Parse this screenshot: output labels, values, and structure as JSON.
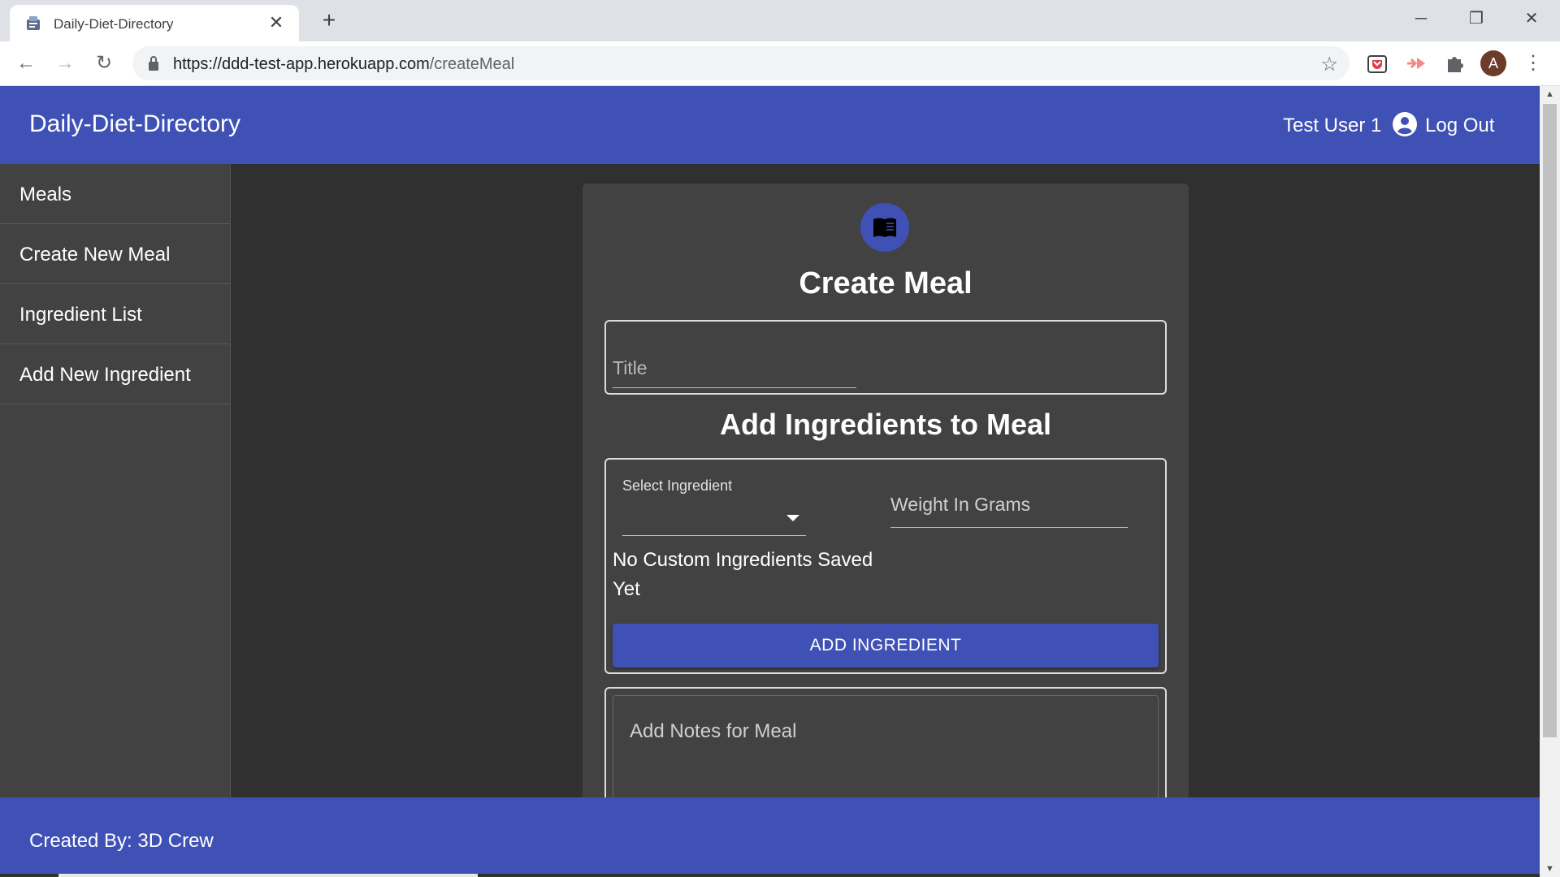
{
  "browser": {
    "tab_title": "Daily-Diet-Directory",
    "url_base": "https://ddd-test-app.herokuapp.com",
    "url_path": "/createMeal",
    "profile_initial": "A"
  },
  "header": {
    "brand": "Daily-Diet-Directory",
    "user_name": "Test User 1",
    "logout_label": "Log Out"
  },
  "sidebar": {
    "items": [
      {
        "label": "Meals"
      },
      {
        "label": "Create New Meal"
      },
      {
        "label": "Ingredient List"
      },
      {
        "label": "Add New Ingredient"
      }
    ]
  },
  "form": {
    "title": "Create Meal",
    "title_placeholder": "Title",
    "ingredients_heading": "Add Ingredients to Meal",
    "select_label": "Select Ingredient",
    "select_value": "",
    "weight_placeholder": "Weight In Grams",
    "no_custom_message": "No Custom Ingredients Saved Yet",
    "add_button_label": "ADD INGREDIENT",
    "notes_placeholder": "Add Notes for Meal"
  },
  "footer": {
    "text": "Created By: 3D Crew"
  },
  "colors": {
    "primary": "#3f51b5",
    "background": "#303030",
    "card": "#424242",
    "sidebar": "#424242"
  }
}
